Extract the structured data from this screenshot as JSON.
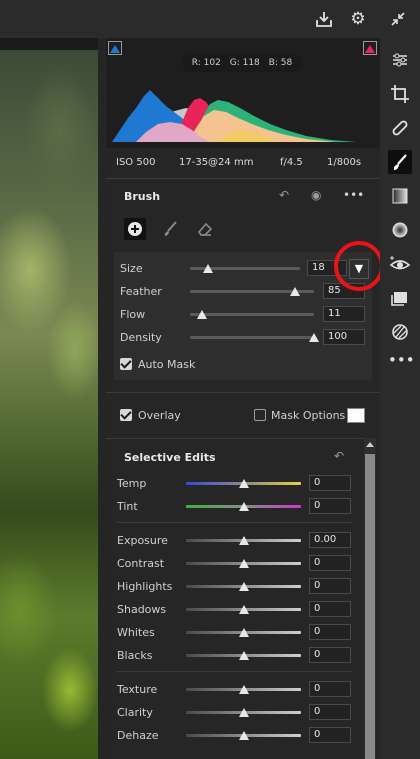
{
  "histogram": {
    "r_label": "R: 102",
    "g_label": "G: 118",
    "b_label": "B: 58",
    "colors": {
      "blue": "#1f78d1",
      "red": "#e8245a",
      "green": "#2db37a",
      "yellow": "#f2d14a",
      "peach": "#f5c38f",
      "gray": "#c8c8c8"
    }
  },
  "camera": {
    "iso": "ISO 500",
    "lens": "17-35@24 mm",
    "aperture": "f/4.5",
    "shutter": "1/800s"
  },
  "brush": {
    "title": "Brush",
    "params": [
      {
        "label": "Size",
        "value": "18",
        "level": 0.15
      },
      {
        "label": "Feather",
        "value": "85",
        "level": 0.85
      },
      {
        "label": "Flow",
        "value": "11",
        "level": 0.1
      },
      {
        "label": "Density",
        "value": "100",
        "level": 1.0
      }
    ],
    "auto_mask_label": "Auto Mask",
    "dropdown_glyph": "▼"
  },
  "overlay": {
    "overlay_label": "Overlay",
    "mask_options_label": "Mask Options"
  },
  "selective": {
    "title": "Selective Edits",
    "group1": [
      {
        "label": "Temp",
        "value": "0"
      },
      {
        "label": "Tint",
        "value": "0"
      }
    ],
    "group2": [
      {
        "label": "Exposure",
        "value": "0.00"
      },
      {
        "label": "Contrast",
        "value": "0"
      },
      {
        "label": "Highlights",
        "value": "0"
      },
      {
        "label": "Shadows",
        "value": "0"
      },
      {
        "label": "Whites",
        "value": "0"
      },
      {
        "label": "Blacks",
        "value": "0"
      }
    ],
    "group3": [
      {
        "label": "Texture",
        "value": "0"
      },
      {
        "label": "Clarity",
        "value": "0"
      },
      {
        "label": "Dehaze",
        "value": "0"
      }
    ]
  },
  "accent": {
    "red_highlight": "#e8141a"
  }
}
